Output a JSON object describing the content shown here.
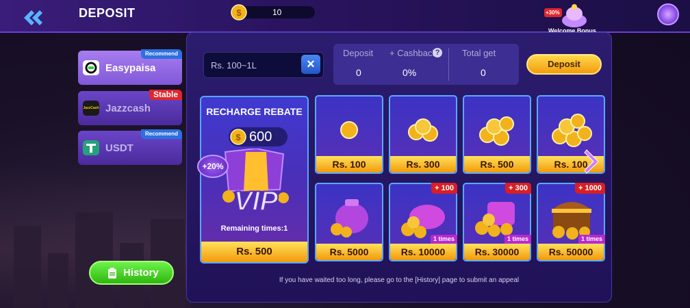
{
  "header": {
    "title": "DEPOSIT",
    "balance": "10",
    "bonus_label": "Welcome Bonus",
    "bonus_badge": "+30%"
  },
  "methods": [
    {
      "name": "Easypaisa",
      "tag": "Recommend",
      "active": true
    },
    {
      "name": "Jazzcash",
      "tag": "Stable",
      "icon_text": "JazzCash",
      "active": false
    },
    {
      "name": "USDT",
      "tag": "Recommend",
      "active": false
    }
  ],
  "history_label": "History",
  "amount_input": {
    "placeholder": "Rs.  100~1L",
    "clear_icon": "close-icon"
  },
  "summary": {
    "deposit_label": "Deposit",
    "cashback_label": "+ Cashback",
    "total_label": "Total get",
    "deposit_value": "0",
    "cashback_value": "0%",
    "total_value": "0",
    "help_icon": "?"
  },
  "deposit_button": "Deposit",
  "vip_card": {
    "title": "RECHARGE REBATE",
    "coins": "600",
    "bonus": "+20%",
    "vip_text": "VIP",
    "remaining": "Remaining times:1",
    "price": "Rs. 500"
  },
  "tiles": [
    {
      "price": "Rs. 100",
      "plus": "",
      "times": ""
    },
    {
      "price": "Rs. 300",
      "plus": "",
      "times": ""
    },
    {
      "price": "Rs. 500",
      "plus": "",
      "times": ""
    },
    {
      "price": "Rs. 100",
      "plus": "",
      "times": ""
    },
    {
      "price": "Rs. 5000",
      "plus": "",
      "times": ""
    },
    {
      "price": "Rs. 10000",
      "plus": "+ 100",
      "times": "1 times"
    },
    {
      "price": "Rs. 30000",
      "plus": "+ 300",
      "times": "1 times"
    },
    {
      "price": "Rs. 50000",
      "plus": "+ 1000",
      "times": "1 times"
    }
  ],
  "note": "If you have waited too long, please go to the [History] page to submit an appeal",
  "colors": {
    "accent_gold": "#f49b0e",
    "panel": "#2c1c6e",
    "green": "#2fb60f",
    "tile_border": "#5aa8ff"
  }
}
